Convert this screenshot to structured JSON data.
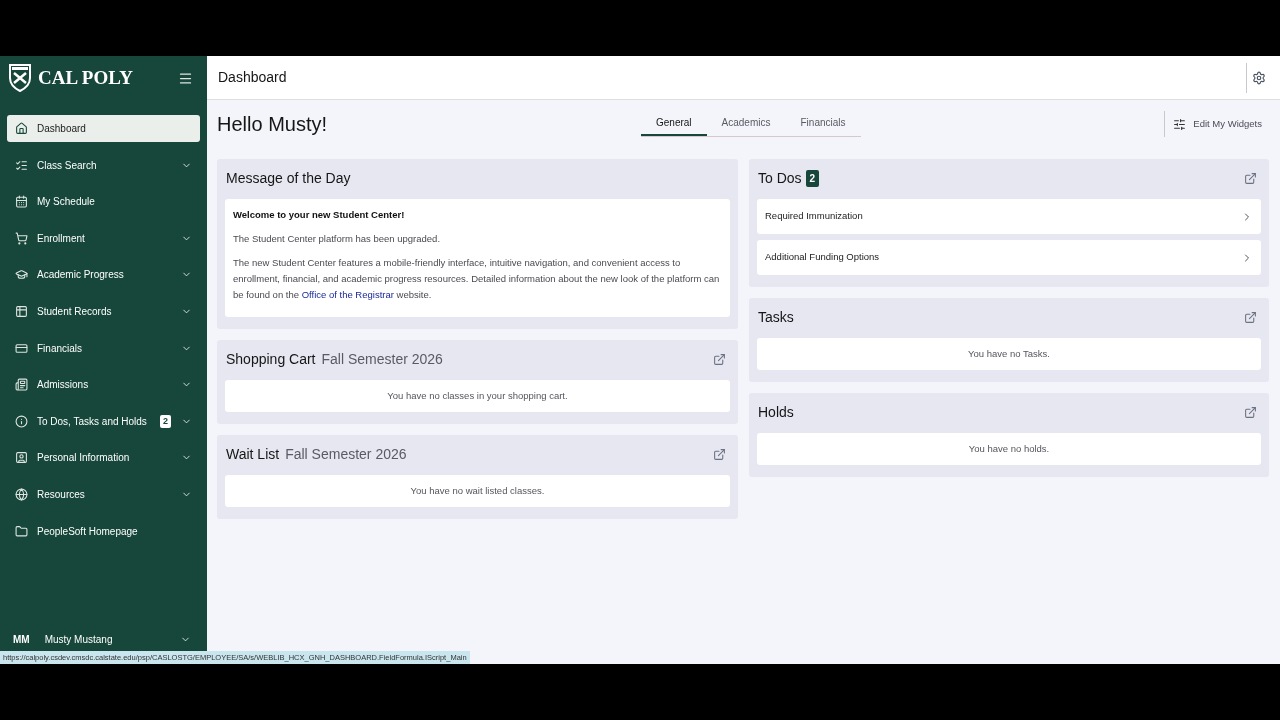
{
  "sidebar": {
    "logo": "CAL POLY",
    "items": [
      {
        "label": "Dashboard",
        "selected": true,
        "expandable": false
      },
      {
        "label": "Class Search",
        "selected": false,
        "expandable": true
      },
      {
        "label": "My Schedule",
        "selected": false,
        "expandable": false
      },
      {
        "label": "Enrollment",
        "selected": false,
        "expandable": true
      },
      {
        "label": "Academic Progress",
        "selected": false,
        "expandable": true
      },
      {
        "label": "Student Records",
        "selected": false,
        "expandable": true
      },
      {
        "label": "Financials",
        "selected": false,
        "expandable": true
      },
      {
        "label": "Admissions",
        "selected": false,
        "expandable": true
      },
      {
        "label": "To Dos, Tasks and Holds",
        "selected": false,
        "expandable": true,
        "badge": "2"
      },
      {
        "label": "Personal Information",
        "selected": false,
        "expandable": true
      },
      {
        "label": "Resources",
        "selected": false,
        "expandable": true
      },
      {
        "label": "PeopleSoft Homepage",
        "selected": false,
        "expandable": false
      }
    ],
    "user": {
      "initials": "MM",
      "name": "Musty Mustang"
    }
  },
  "header": {
    "title": "Dashboard"
  },
  "greeting": "Hello Musty!",
  "tabs": [
    {
      "label": "General",
      "selected": true
    },
    {
      "label": "Academics",
      "selected": false
    },
    {
      "label": "Financials",
      "selected": false
    }
  ],
  "edit_button": "Edit My Widgets",
  "left_widgets": [
    {
      "kind": "message",
      "title": "Message of the Day",
      "heading": "Welcome to your new Student Center!",
      "lines": [
        "The Student Center platform has been upgraded."
      ],
      "paragraph": {
        "before": "The new Student Center features a mobile-friendly interface, intuitive navigation, and convenient access to enrollment, financial, and academic progress resources. Detailed information about the new look of the platform can be found on the ",
        "link": "Office of the Registrar",
        "after": " website."
      }
    },
    {
      "kind": "empty",
      "title": "Shopping Cart",
      "subtitle": "Fall Semester 2026",
      "message": "You have no classes in your shopping cart."
    },
    {
      "kind": "empty",
      "title": "Wait List",
      "subtitle": "Fall Semester 2026",
      "message": "You have no wait listed classes."
    }
  ],
  "right_widgets": [
    {
      "kind": "list",
      "title": "To Dos",
      "badge": "2",
      "items": [
        "Required Immunization",
        "Additional Funding Options"
      ]
    },
    {
      "kind": "empty",
      "title": "Tasks",
      "message": "You have no Tasks."
    },
    {
      "kind": "empty",
      "title": "Holds",
      "message": "You have no holds."
    }
  ],
  "status_bar": "https://calpoly.csdev.cmsdc.calstate.edu/psp/CASLOSTG/EMPLOYEE/SA/s/WEBLIB_HCX_GNH_DASHBOARD.FieldFormula.IScript_Main"
}
